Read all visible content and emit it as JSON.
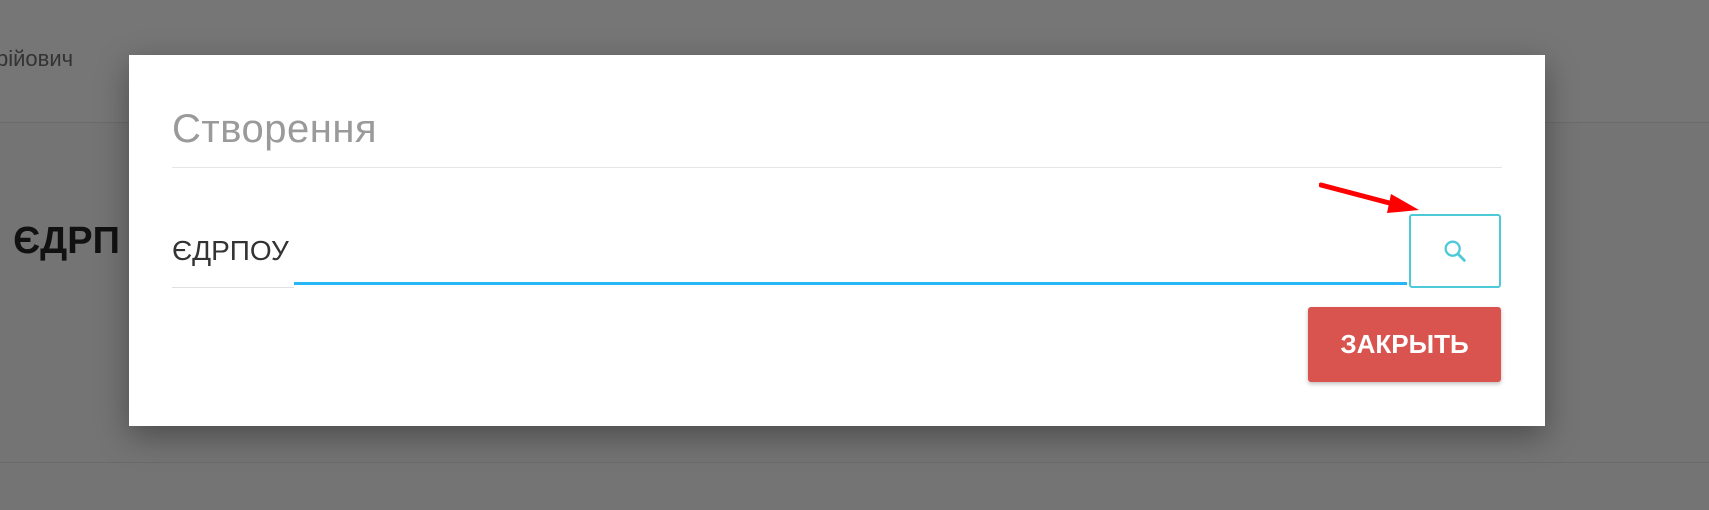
{
  "background": {
    "user_name_fragment": "рійович",
    "heading_fragment": "і ЄДРП"
  },
  "modal": {
    "title": "Створення",
    "field": {
      "label": "ЄДРПОУ",
      "value": "",
      "placeholder": ""
    },
    "search_button_icon": "search-icon",
    "close_button_label": "ЗАКРЫТЬ"
  },
  "colors": {
    "input_focus": "#29b6f6",
    "search_border": "#4dc9d8",
    "close_button": "#d9534f",
    "annotation_arrow": "#ff0000"
  }
}
